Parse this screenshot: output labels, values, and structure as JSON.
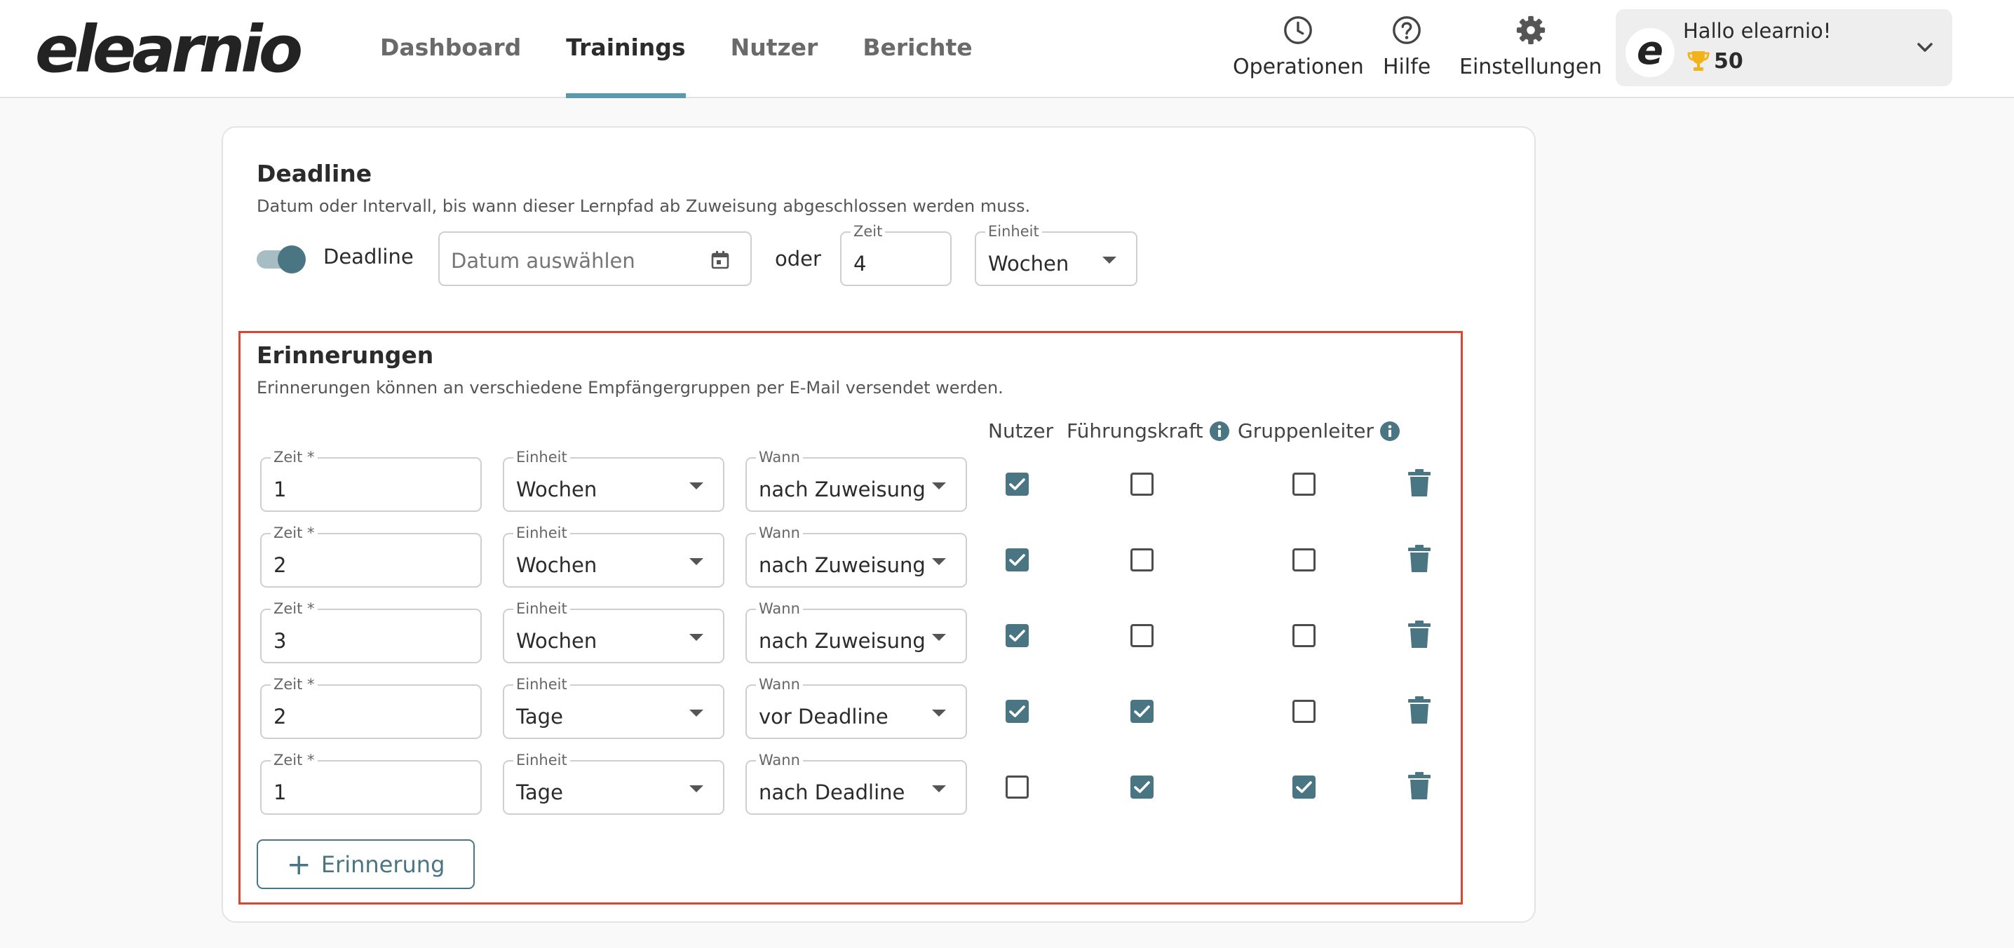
{
  "header": {
    "logo": "elearnio",
    "nav": [
      {
        "label": "Dashboard",
        "active": false
      },
      {
        "label": "Trainings",
        "active": true
      },
      {
        "label": "Nutzer",
        "active": false
      },
      {
        "label": "Berichte",
        "active": false
      }
    ],
    "tools": [
      {
        "label": "Operationen",
        "icon": "clock-icon"
      },
      {
        "label": "Hilfe",
        "icon": "help-circle-icon"
      },
      {
        "label": "Einstellungen",
        "icon": "gear-icon"
      }
    ],
    "user": {
      "avatar_letter": "e",
      "greeting": "Hallo elearnio!",
      "points": "50",
      "points_icon": "trophy-icon"
    }
  },
  "deadline": {
    "title": "Deadline",
    "description": "Datum oder Intervall, bis wann dieser Lernpfad ab Zuweisung abgeschlossen werden muss.",
    "toggle_label": "Deadline",
    "toggle_on": true,
    "date_placeholder": "Datum auswählen",
    "or_label": "oder",
    "time_label": "Zeit",
    "time_value": "4",
    "unit_label": "Einheit",
    "unit_value": "Wochen"
  },
  "reminders": {
    "title": "Erinnerungen",
    "description": "Erinnerungen können an verschiedene Empfängergruppen per E-Mail versendet werden.",
    "col_user": "Nutzer",
    "col_manager": "Führungskraft",
    "col_group_lead": "Gruppenleiter",
    "time_label": "Zeit *",
    "unit_label": "Einheit",
    "when_label": "Wann",
    "rows": [
      {
        "time": "1",
        "unit": "Wochen",
        "when": "nach Zuweisung",
        "user": true,
        "manager": false,
        "group_lead": false
      },
      {
        "time": "2",
        "unit": "Wochen",
        "when": "nach Zuweisung",
        "user": true,
        "manager": false,
        "group_lead": false
      },
      {
        "time": "3",
        "unit": "Wochen",
        "when": "nach Zuweisung",
        "user": true,
        "manager": false,
        "group_lead": false
      },
      {
        "time": "2",
        "unit": "Tage",
        "when": "vor Deadline",
        "user": true,
        "manager": true,
        "group_lead": false
      },
      {
        "time": "1",
        "unit": "Tage",
        "when": "nach Deadline",
        "user": false,
        "manager": true,
        "group_lead": true
      }
    ],
    "add_button": "Erinnerung"
  },
  "colors": {
    "accent": "#4a7583",
    "nav_underline": "#5a9aad",
    "highlight_border": "#e0442e",
    "trophy": "#f2b21a"
  }
}
